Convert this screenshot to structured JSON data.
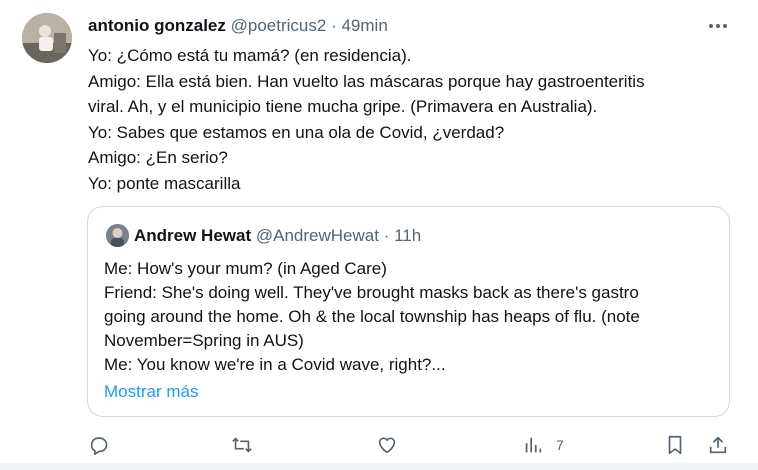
{
  "tweet": {
    "author_name": "antonio gonzalez",
    "author_handle": "@poetricus2",
    "separator": "·",
    "time": "49min",
    "lines": [
      "Yo: ¿Cómo está tu mamá? (en residencia).",
      " Amigo: Ella está bien. Han vuelto las máscaras porque hay gastroenteritis",
      "viral. Ah, y el municipio tiene mucha gripe. (Primavera en Australia).",
      " Yo: Sabes que estamos en una ola de Covid, ¿verdad?",
      " Amigo: ¿En serio?",
      " Yo: ponte mascarilla"
    ]
  },
  "quote": {
    "author_name": "Andrew Hewat",
    "author_handle": "@AndrewHewat",
    "separator": "·",
    "time": "11h",
    "lines": [
      "Me: How's your mum? (in Aged Care)",
      "Friend: She's doing well. They've brought masks back as there's gastro",
      "going around the home. Oh & the local township has heaps of flu. (note",
      "November=Spring in AUS)",
      "Me: You know we're in a Covid wave, right?..."
    ],
    "show_more": "Mostrar más"
  },
  "actions": {
    "reply": {
      "icon": "reply-icon"
    },
    "retweet": {
      "icon": "retweet-icon"
    },
    "like": {
      "icon": "heart-icon"
    },
    "views": {
      "icon": "views-icon",
      "count": "7"
    },
    "bookmark": {
      "icon": "bookmark-icon"
    },
    "share": {
      "icon": "share-icon"
    }
  },
  "colors": {
    "text": "#0f1419",
    "secondary": "#536471",
    "link": "#1d9bf0",
    "border": "#cfd9de"
  }
}
